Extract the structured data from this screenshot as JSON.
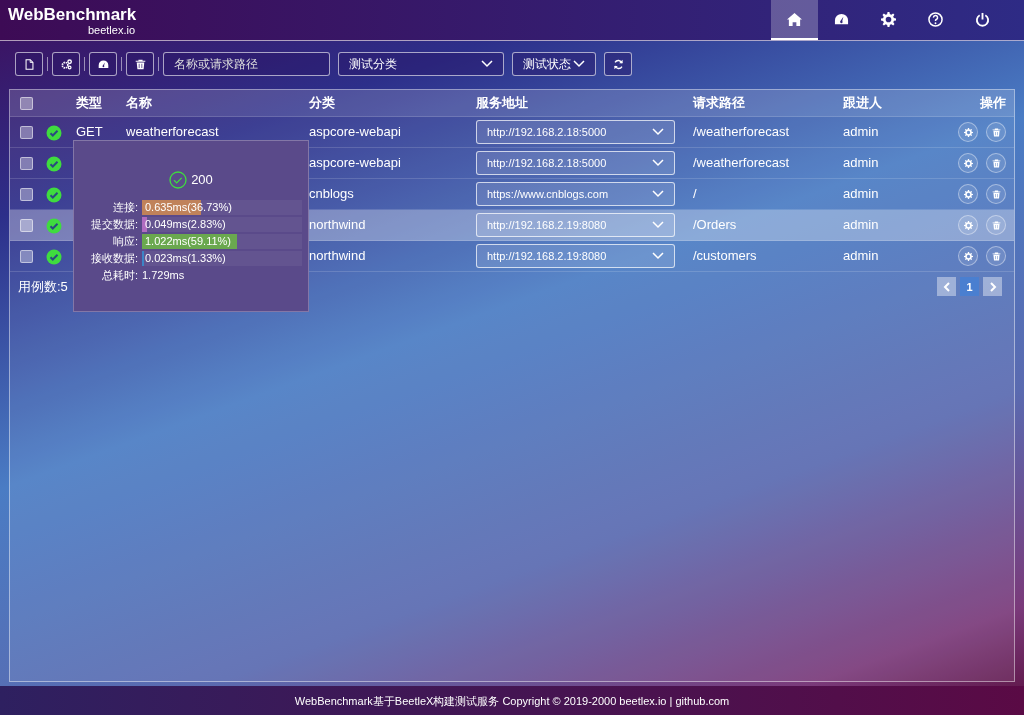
{
  "brand": {
    "title": "WebBenchmark",
    "subtitle": "beetlex.io"
  },
  "nav": [
    {
      "selected": true
    },
    {
      "selected": false
    },
    {
      "selected": false
    },
    {
      "selected": false
    },
    {
      "selected": false
    }
  ],
  "toolbar": {
    "search": {
      "placeholder": "名称或请求路径"
    },
    "category_select": {
      "value": "测试分类"
    },
    "status_select": {
      "value": "测试状态"
    }
  },
  "table": {
    "all_checked": false,
    "columns": [
      "类型",
      "名称",
      "分类",
      "服务地址",
      "请求路径",
      "跟进人",
      "操作"
    ],
    "rows": [
      {
        "checked": false,
        "ok": true,
        "type": "GET",
        "name": "weatherforecast",
        "category": "aspcore-webapi",
        "server": "http://192.168.2.18:5000",
        "path": "/weatherforecast",
        "follower": "admin",
        "highlighted": false
      },
      {
        "checked": false,
        "ok": true,
        "category": "aspcore-webapi",
        "server": "http://192.168.2.18:5000",
        "path": "/weatherforecast",
        "follower": "admin",
        "highlighted": false
      },
      {
        "checked": false,
        "ok": true,
        "category": "cnblogs",
        "server": "https://www.cnblogs.com",
        "path": "/",
        "follower": "admin",
        "highlighted": false
      },
      {
        "checked": false,
        "ok": true,
        "category": "northwind",
        "server": "http://192.168.2.19:8080",
        "path": "/Orders",
        "follower": "admin",
        "highlighted": true
      },
      {
        "checked": false,
        "ok": true,
        "category": "northwind",
        "server": "http://192.168.2.19:8080",
        "path": "/customers",
        "follower": "admin",
        "highlighted": false
      }
    ],
    "count": "用例数:5",
    "pages": [
      {
        "label": "1",
        "selected": true
      }
    ]
  },
  "tooltip": {
    "status": "200",
    "timings": [
      {
        "label": "连接:",
        "reading": "0.635ms(36.73%)",
        "level": 0.3673,
        "color": "#c0825a"
      },
      {
        "label": "提交数据:",
        "reading": "0.049ms(2.83%)",
        "level": 0.0283,
        "color": "#b06cc0"
      },
      {
        "label": "响应:",
        "reading": "1.022ms(59.11%)",
        "level": 0.5911,
        "color": "#6aa84f"
      },
      {
        "label": "接收数据:",
        "reading": "0.023ms(1.33%)",
        "level": 0.0133,
        "color": "#3d85c6"
      }
    ],
    "total_label": "总耗时:",
    "total": "1.729ms"
  },
  "footer": "WebBenchmark基于BeetleX构建测试服务 Copyright © 2019-2000 beetlex.io | github.com"
}
